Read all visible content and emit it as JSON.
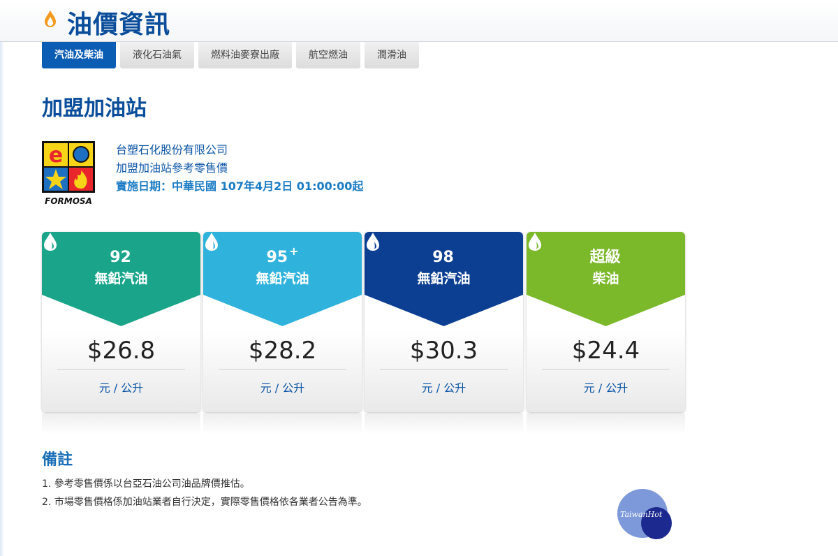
{
  "page": {
    "title": "油價資訊"
  },
  "tabs": [
    {
      "label": "汽油及柴油",
      "active": true
    },
    {
      "label": "液化石油氣",
      "active": false
    },
    {
      "label": "燃料油麥寮出廠",
      "active": false
    },
    {
      "label": "航空燃油",
      "active": false
    },
    {
      "label": "潤滑油",
      "active": false
    }
  ],
  "section": {
    "title": "加盟加油站"
  },
  "company": {
    "name": "台塑石化股份有限公司",
    "subtitle": "加盟加油站參考零售價",
    "effective_date": "實施日期：中華民國 107年4月2日 01:00:00起",
    "logo_text": "FORMOSA"
  },
  "fuels": [
    {
      "grade": "92",
      "grade_suffix": "",
      "type": "無鉛汽油",
      "price": "$26.8",
      "unit": "元 / 公升",
      "color": "#1aa58b",
      "color_light": "#2cbfa0"
    },
    {
      "grade": "95",
      "grade_suffix": "+",
      "type": "無鉛汽油",
      "price": "$28.2",
      "unit": "元 / 公升",
      "color": "#2fb3dd",
      "color_light": "#45c4ea"
    },
    {
      "grade": "98",
      "grade_suffix": "",
      "type": "無鉛汽油",
      "price": "$30.3",
      "unit": "元 / 公升",
      "color": "#0c3f91",
      "color_light": "#1753aa"
    },
    {
      "grade": "超級",
      "grade_suffix": "",
      "type": "柴油",
      "price": "$24.4",
      "unit": "元 / 公升",
      "color": "#7bb82a",
      "color_light": "#92c93a"
    }
  ],
  "notes": {
    "title": "備註",
    "items": [
      "1. 參考零售價係以台亞石油公司油品牌價推估。",
      "2. 市場零售價格係加油站業者自行決定，實際零售價格依各業者公告為準。"
    ]
  },
  "watermark": {
    "text": "TaiwanHot"
  },
  "colors": {
    "brand_blue": "#0a4d9a",
    "tab_active": "#0b5cb3"
  }
}
